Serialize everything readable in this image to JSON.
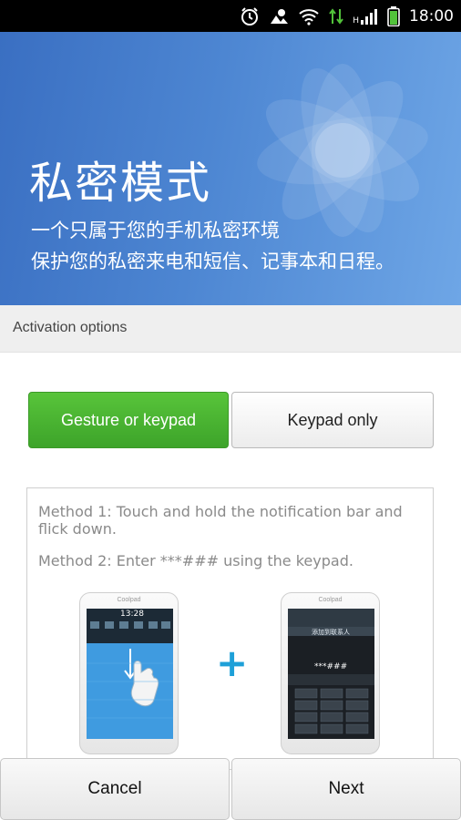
{
  "status_bar": {
    "time": "18:00",
    "icons": [
      "alarm-icon",
      "weather-icon",
      "wifi-icon",
      "data-transfer-icon",
      "signal-icon",
      "battery-icon"
    ],
    "network_label": "H"
  },
  "hero": {
    "title": "私密模式",
    "subtitle_line1": "一个只属于您的手机私密环境",
    "subtitle_line2": "保护您的私密来电和短信、记事本和日程。",
    "background_color": "#4a82d0"
  },
  "section": {
    "header": "Activation options"
  },
  "options": {
    "gesture_label": "Gesture or keypad",
    "keypad_label": "Keypad only",
    "selected": "Gesture or keypad",
    "active_color": "#46b32f"
  },
  "methods": {
    "method1": "Method 1: Touch and hold the notification bar and flick down.",
    "method2": "Method 2: Enter ***### using the keypad."
  },
  "illustration": {
    "phone_brand": "Coolpad",
    "phone1_time": "13:28",
    "phone2_code": "***###",
    "phone2_header": "添加到联系人",
    "plus_symbol": "+"
  },
  "footer": {
    "cancel_label": "Cancel",
    "next_label": "Next"
  }
}
